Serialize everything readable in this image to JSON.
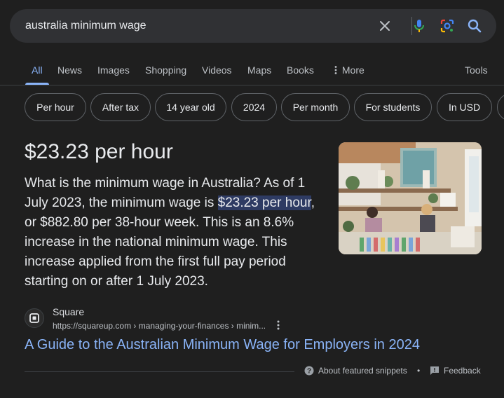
{
  "search": {
    "query": "australia minimum wage"
  },
  "tabs": [
    {
      "label": "All",
      "active": true
    },
    {
      "label": "News"
    },
    {
      "label": "Images"
    },
    {
      "label": "Shopping"
    },
    {
      "label": "Videos"
    },
    {
      "label": "Maps"
    },
    {
      "label": "Books"
    },
    {
      "label": "More"
    }
  ],
  "tools_label": "Tools",
  "chips": [
    "Per hour",
    "After tax",
    "14 year old",
    "2024",
    "Per month",
    "For students",
    "In USD"
  ],
  "featured": {
    "answer": "$23.23 per hour",
    "snippet_before": "What is the minimum wage in Australia? As of 1 July 2023, the minimum wage is ",
    "snippet_highlight": "$23.23 per hour",
    "snippet_after": ", or $882.80 per 38-hour week. This is an 8.6% increase in the national minimum wage. This increase applied from the first full pay period starting on or after 1 July 2023."
  },
  "source": {
    "name": "Square",
    "url": "https://squareup.com › managing-your-finances › minim...",
    "title": "A Guide to the Australian Minimum Wage for Employers in 2024"
  },
  "footer": {
    "about": "About featured snippets",
    "separator": "•",
    "feedback": "Feedback"
  },
  "colors": {
    "background": "#1f1f1f",
    "link": "#8ab4f8",
    "highlight": "#2e3b63"
  }
}
